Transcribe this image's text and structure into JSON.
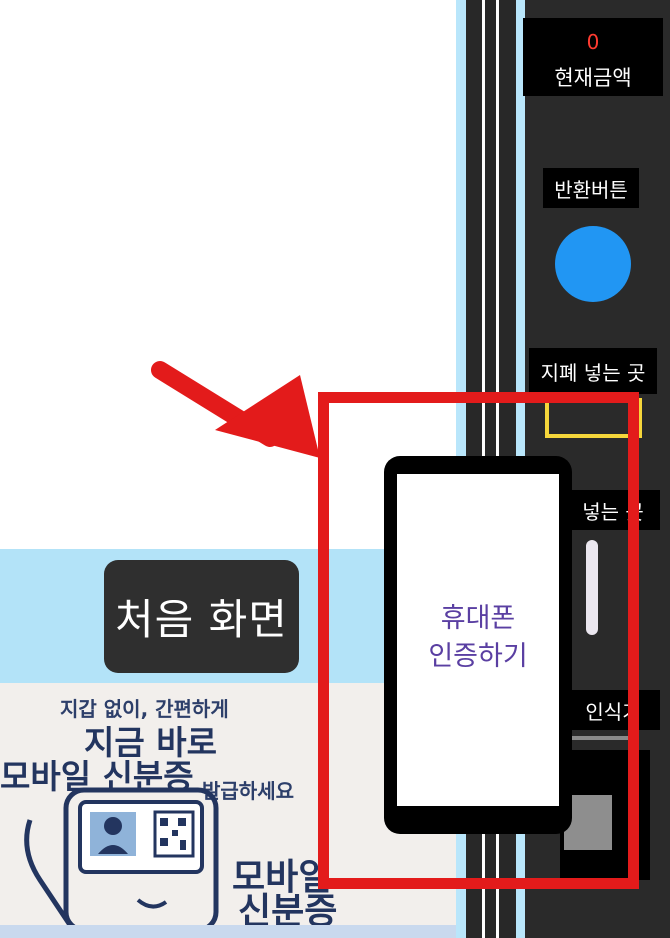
{
  "home": {
    "label": "처음 화면"
  },
  "banner": {
    "line1": "지갑 없이, 간편하게",
    "line2": "지금 바로",
    "line3": "모바일 신분증",
    "line4": "발급하세요",
    "card_line1": "모바일",
    "card_line2": "신분증"
  },
  "panel": {
    "amount_value": "0",
    "amount_label": "현재금액",
    "return_label": "반환버튼",
    "bill_label": "지폐 넣는 곳",
    "coin_label": "넣는 곳",
    "scan_label": "인식기"
  },
  "phone": {
    "cert_label": "휴대폰\n인증하기"
  },
  "colors": {
    "highlight": "#e31b1b",
    "return_button": "#2196f3",
    "amount": "#ff3b30",
    "accent_text": "#5a3fa2"
  }
}
